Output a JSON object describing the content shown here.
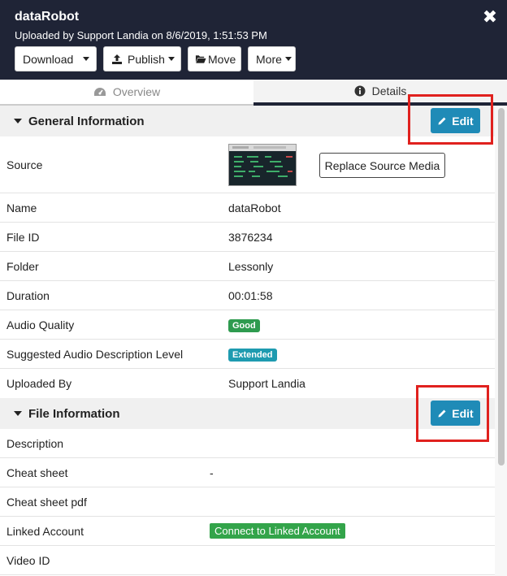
{
  "header": {
    "title": "dataRobot",
    "subtitle": "Uploaded by Support Landia on 8/6/2019, 1:51:53 PM",
    "close_icon": "close-icon",
    "toolbar": {
      "download_label": "Download",
      "publish_label": "Publish",
      "move_label": "Move",
      "more_label": "More"
    }
  },
  "tabs": {
    "overview": "Overview",
    "details": "Details"
  },
  "general": {
    "heading": "General Information",
    "edit_label": "Edit",
    "rows": {
      "source_label": "Source",
      "replace_label": "Replace Source Media",
      "name_label": "Name",
      "name_value": "dataRobot",
      "fileid_label": "File ID",
      "fileid_value": "3876234",
      "folder_label": "Folder",
      "folder_value": "Lessonly",
      "duration_label": "Duration",
      "duration_value": "00:01:58",
      "audio_label": "Audio Quality",
      "audio_value": "Good",
      "suggested_label": "Suggested Audio Description Level",
      "suggested_value": "Extended",
      "uploaded_label": "Uploaded By",
      "uploaded_value": "Support Landia"
    }
  },
  "file_info": {
    "heading": "File Information",
    "edit_label": "Edit",
    "rows": {
      "description_label": "Description",
      "cheat_label": "Cheat sheet",
      "cheat_value": "-",
      "cheatpdf_label": "Cheat sheet pdf",
      "linked_label": "Linked Account",
      "linked_value": "Connect to Linked Account",
      "videoid_label": "Video ID"
    }
  },
  "colors": {
    "header_bg": "#1f2436",
    "edit_blue": "#1f8bb7",
    "highlight_red": "#e0211e",
    "good_green": "#2e9b4f",
    "extended_teal": "#1e9bb0",
    "connect_green": "#33a44a"
  }
}
